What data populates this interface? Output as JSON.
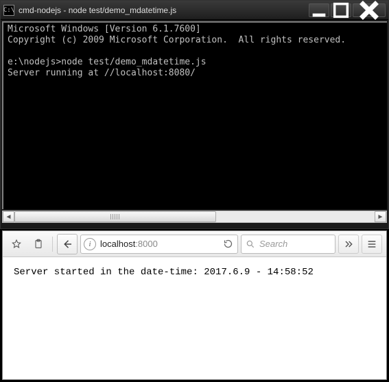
{
  "cmd": {
    "title": "cmd-nodejs - node  test/demo_mdatetime.js",
    "icon_text": "C:\\",
    "lines": {
      "l1": "Microsoft Windows [Version 6.1.7600]",
      "l2": "Copyright (c) 2009 Microsoft Corporation.  All rights reserved.",
      "l3": "",
      "l4": "e:\\nodejs>node test/demo_mdatetime.js",
      "l5": "Server running at //localhost:8080/"
    }
  },
  "browser": {
    "url_host": "localhost",
    "url_port": ":8000",
    "search_placeholder": "Search",
    "page_text": "Server started in the date-time: 2017.6.9 - 14:58:52"
  },
  "win_controls": {
    "minimize": "—",
    "maximize": "□",
    "close": "X"
  }
}
